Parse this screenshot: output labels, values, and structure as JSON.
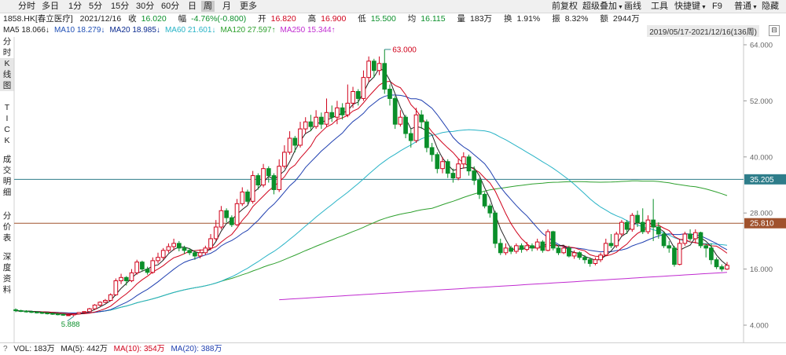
{
  "tabs": [
    "分时",
    "多日",
    "1分",
    "5分",
    "15分",
    "30分",
    "60分",
    "日",
    "周",
    "月",
    "更多"
  ],
  "active_tab": 8,
  "toolbar": {
    "qfq": "前复权",
    "overlay": "超级叠加",
    "draw": "画线",
    "tools": "工具",
    "shortcut": "快捷键",
    "f9": "F9",
    "normal": "普通",
    "hide": "隐藏"
  },
  "quote": {
    "symbol": "1858.HK[春立医疗]",
    "date": "2021/12/16",
    "close_label": "收",
    "close": "16.020",
    "change_label": "幅",
    "change": "-4.76%(-0.800)",
    "open_label": "开",
    "open": "16.820",
    "high_label": "高",
    "high": "16.900",
    "low_label": "低",
    "low": "15.500",
    "avg_label": "均",
    "avg": "16.115",
    "amount_label": "量",
    "amount": "183万",
    "turnover_label": "换",
    "turnover": "1.91%",
    "amplitude_label": "振",
    "amplitude": "8.32%",
    "value_label": "额",
    "value": "2944万"
  },
  "ma_legend": [
    {
      "text": "MA5 18.066↓",
      "color": "#222222"
    },
    {
      "text": "MA10 18.279↓",
      "color": "#1f4fb5"
    },
    {
      "text": "MA20 18.985↓",
      "color": "#0a2a8f"
    },
    {
      "text": "MA60 21.601↓",
      "color": "#27b3c6"
    },
    {
      "text": "MA120 27.597↑",
      "color": "#2ea02e"
    },
    {
      "text": "MA250 15.344↑",
      "color": "#c02ad0"
    }
  ],
  "period": "2019/05/17-2021/12/16(136周)",
  "period_button": "⊟",
  "side_tabs": [
    "分时图",
    "K线图",
    "TICK",
    "成交明细",
    "分价表",
    "深度资料"
  ],
  "side_active": 1,
  "colors": {
    "up": "#d0021b",
    "down": "#0a8f2a",
    "ma5": "#222222",
    "ma10": "#d0021b",
    "ma20": "#1f3fb0",
    "ma60": "#27b3c6",
    "ma120": "#2ea02e",
    "ma250": "#c02ad0",
    "hline1": "#2e7d8a",
    "hline2": "#a0522d"
  },
  "chart_data": {
    "type": "candlestick",
    "yticks": [
      64.0,
      52.0,
      40.0,
      28.0,
      16.0,
      4.0
    ],
    "ylim": [
      4,
      64
    ],
    "n": 136,
    "price_labels": [
      {
        "value": 35.205,
        "text": "35.205"
      },
      {
        "value": 25.81,
        "text": "25.810"
      }
    ],
    "max_label": {
      "index": 70,
      "value": 63.0,
      "text": "63.000"
    },
    "min_label": {
      "index": 11,
      "value": 5.888,
      "text": "5.888"
    },
    "candles": [
      [
        7.3,
        7.1,
        7.6,
        6.8
      ],
      [
        7.1,
        7.0,
        7.3,
        6.8
      ],
      [
        7.0,
        6.9,
        7.2,
        6.7
      ],
      [
        6.9,
        6.8,
        7.1,
        6.6
      ],
      [
        6.8,
        6.7,
        7.0,
        6.5
      ],
      [
        6.7,
        6.6,
        6.9,
        6.4
      ],
      [
        6.6,
        6.5,
        6.8,
        6.3
      ],
      [
        6.5,
        6.4,
        6.7,
        6.2
      ],
      [
        6.4,
        6.3,
        6.6,
        6.1
      ],
      [
        6.3,
        6.2,
        6.5,
        6.0
      ],
      [
        6.2,
        6.2,
        6.4,
        5.95
      ],
      [
        6.2,
        6.4,
        6.5,
        5.89
      ],
      [
        6.4,
        6.7,
        6.8,
        6.3
      ],
      [
        6.7,
        6.9,
        7.0,
        6.6
      ],
      [
        6.9,
        7.5,
        7.7,
        6.8
      ],
      [
        7.5,
        8.3,
        8.5,
        7.4
      ],
      [
        8.3,
        8.9,
        9.1,
        8.0
      ],
      [
        8.9,
        9.3,
        9.6,
        8.7
      ],
      [
        9.3,
        10.5,
        10.8,
        9.1
      ],
      [
        10.5,
        13.5,
        14.0,
        10.3
      ],
      [
        13.5,
        14.2,
        15.0,
        12.8
      ],
      [
        14.2,
        13.5,
        14.5,
        12.5
      ],
      [
        13.5,
        15.2,
        16.0,
        13.2
      ],
      [
        15.2,
        17.5,
        18.0,
        14.8
      ],
      [
        17.5,
        16.0,
        17.8,
        15.5
      ],
      [
        16.0,
        15.3,
        16.5,
        14.8
      ],
      [
        15.3,
        17.8,
        18.5,
        15.0
      ],
      [
        17.8,
        18.5,
        19.5,
        17.2
      ],
      [
        18.5,
        20.0,
        20.5,
        18.0
      ],
      [
        20.0,
        20.8,
        21.5,
        19.5
      ],
      [
        20.8,
        21.5,
        22.5,
        20.0
      ],
      [
        21.5,
        20.5,
        22.0,
        19.8
      ],
      [
        20.5,
        20.0,
        21.0,
        19.2
      ],
      [
        20.0,
        19.5,
        20.5,
        19.0
      ],
      [
        19.5,
        18.8,
        20.0,
        18.0
      ],
      [
        18.8,
        19.5,
        20.2,
        18.3
      ],
      [
        19.5,
        20.5,
        21.0,
        19.0
      ],
      [
        20.5,
        22.5,
        23.5,
        20.0
      ],
      [
        22.5,
        25.0,
        26.5,
        22.0
      ],
      [
        25.0,
        28.5,
        29.5,
        24.5
      ],
      [
        28.5,
        27.0,
        29.0,
        26.0
      ],
      [
        27.0,
        25.5,
        27.5,
        25.0
      ],
      [
        25.5,
        30.0,
        31.0,
        25.2
      ],
      [
        30.0,
        32.5,
        33.5,
        29.5
      ],
      [
        32.5,
        30.5,
        33.0,
        30.0
      ],
      [
        30.5,
        36.0,
        37.0,
        30.0
      ],
      [
        36.0,
        34.0,
        36.5,
        33.0
      ],
      [
        34.0,
        37.5,
        38.5,
        33.5
      ],
      [
        37.5,
        36.0,
        38.0,
        34.5
      ],
      [
        36.0,
        33.0,
        36.5,
        32.0
      ],
      [
        33.0,
        38.0,
        39.5,
        32.5
      ],
      [
        38.0,
        41.0,
        42.5,
        37.5
      ],
      [
        41.0,
        44.0,
        45.5,
        40.5
      ],
      [
        44.0,
        42.5,
        44.5,
        41.0
      ],
      [
        42.5,
        46.0,
        47.5,
        42.0
      ],
      [
        46.0,
        47.5,
        48.5,
        45.0
      ],
      [
        47.5,
        46.5,
        49.0,
        45.5
      ],
      [
        46.5,
        48.5,
        50.0,
        46.0
      ],
      [
        48.5,
        47.0,
        49.5,
        46.0
      ],
      [
        47.0,
        49.5,
        52.5,
        46.5
      ],
      [
        49.5,
        48.5,
        51.0,
        47.5
      ],
      [
        48.5,
        50.5,
        52.0,
        47.0
      ],
      [
        50.5,
        49.0,
        51.5,
        48.0
      ],
      [
        49.0,
        51.5,
        55.5,
        48.5
      ],
      [
        51.5,
        54.0,
        55.0,
        50.5
      ],
      [
        54.0,
        52.5,
        54.5,
        51.0
      ],
      [
        52.5,
        57.0,
        58.5,
        52.0
      ],
      [
        57.0,
        60.5,
        61.5,
        56.0
      ],
      [
        60.5,
        58.5,
        61.0,
        57.0
      ],
      [
        58.5,
        60.0,
        61.5,
        57.5
      ],
      [
        60.0,
        54.5,
        63.0,
        53.5
      ],
      [
        54.5,
        52.5,
        55.5,
        51.0
      ],
      [
        52.5,
        47.0,
        53.0,
        46.0
      ],
      [
        47.0,
        48.5,
        50.0,
        46.5
      ],
      [
        48.5,
        45.0,
        49.0,
        44.0
      ],
      [
        45.0,
        43.5,
        46.0,
        42.0
      ],
      [
        43.5,
        49.0,
        50.5,
        43.0
      ],
      [
        49.0,
        47.5,
        50.0,
        46.0
      ],
      [
        47.5,
        42.0,
        48.0,
        41.0
      ],
      [
        42.0,
        40.5,
        43.0,
        39.0
      ],
      [
        40.5,
        37.5,
        41.0,
        36.5
      ],
      [
        37.5,
        39.0,
        40.0,
        36.5
      ],
      [
        39.0,
        36.5,
        39.5,
        35.5
      ],
      [
        36.5,
        35.5,
        37.5,
        34.5
      ],
      [
        35.5,
        38.5,
        39.5,
        35.0
      ],
      [
        38.5,
        40.0,
        41.0,
        37.5
      ],
      [
        40.0,
        37.0,
        40.5,
        36.0
      ],
      [
        37.0,
        35.0,
        38.0,
        34.0
      ],
      [
        35.0,
        32.0,
        35.5,
        31.0
      ],
      [
        32.0,
        29.5,
        32.5,
        29.0
      ],
      [
        29.5,
        28.0,
        30.0,
        27.0
      ],
      [
        28.0,
        21.5,
        28.5,
        20.5
      ],
      [
        21.5,
        19.5,
        22.5,
        19.0
      ],
      [
        19.5,
        20.5,
        21.5,
        19.0
      ],
      [
        20.5,
        19.8,
        21.0,
        19.2
      ],
      [
        19.8,
        21.0,
        21.5,
        19.3
      ],
      [
        21.0,
        20.2,
        21.5,
        19.5
      ],
      [
        20.2,
        21.0,
        21.8,
        19.8
      ],
      [
        21.0,
        20.5,
        21.5,
        19.8
      ],
      [
        20.5,
        21.8,
        22.5,
        20.0
      ],
      [
        21.8,
        20.0,
        22.2,
        19.5
      ],
      [
        20.0,
        24.0,
        24.5,
        19.8
      ],
      [
        24.0,
        20.5,
        24.2,
        20.0
      ],
      [
        20.5,
        19.5,
        21.0,
        19.0
      ],
      [
        19.5,
        20.5,
        21.0,
        19.2
      ],
      [
        20.5,
        18.8,
        21.0,
        18.5
      ],
      [
        18.8,
        19.5,
        20.0,
        18.2
      ],
      [
        19.5,
        18.5,
        19.8,
        18.0
      ],
      [
        18.5,
        18.0,
        19.0,
        17.2
      ],
      [
        18.0,
        17.2,
        18.5,
        16.5
      ],
      [
        17.2,
        18.0,
        18.5,
        16.8
      ],
      [
        18.0,
        19.0,
        19.5,
        17.5
      ],
      [
        19.0,
        21.5,
        22.5,
        18.8
      ],
      [
        21.5,
        21.0,
        23.5,
        20.5
      ],
      [
        21.0,
        23.5,
        24.0,
        20.5
      ],
      [
        23.5,
        26.0,
        26.5,
        23.0
      ],
      [
        26.0,
        24.5,
        26.5,
        23.5
      ],
      [
        24.5,
        27.5,
        28.0,
        24.0
      ],
      [
        27.5,
        26.0,
        28.5,
        25.0
      ],
      [
        26.0,
        24.0,
        29.0,
        23.5
      ],
      [
        24.0,
        26.5,
        27.5,
        23.5
      ],
      [
        26.5,
        25.0,
        31.0,
        22.0
      ],
      [
        25.0,
        23.5,
        26.0,
        22.5
      ],
      [
        23.5,
        21.0,
        24.0,
        20.5
      ],
      [
        21.0,
        20.5,
        22.0,
        19.5
      ],
      [
        20.5,
        17.0,
        21.0,
        16.5
      ],
      [
        17.0,
        21.5,
        22.5,
        16.8
      ],
      [
        21.5,
        23.5,
        24.0,
        21.0
      ],
      [
        23.5,
        22.5,
        24.5,
        22.0
      ],
      [
        22.5,
        23.8,
        24.5,
        21.5
      ],
      [
        23.8,
        21.0,
        24.0,
        20.5
      ],
      [
        21.0,
        20.5,
        21.5,
        18.5
      ],
      [
        20.5,
        18.0,
        21.5,
        17.0
      ],
      [
        18.0,
        16.5,
        18.5,
        16.0
      ],
      [
        16.5,
        16.0,
        17.0,
        15.5
      ],
      [
        16.0,
        16.8,
        17.5,
        15.8
      ]
    ],
    "volume_legend": {
      "vol": "VOL: 183万",
      "ma5": "MA(5): 442万",
      "ma10": "MA(10): 354万",
      "ma20": "MA(20): 388万"
    }
  },
  "help_icon": "?"
}
